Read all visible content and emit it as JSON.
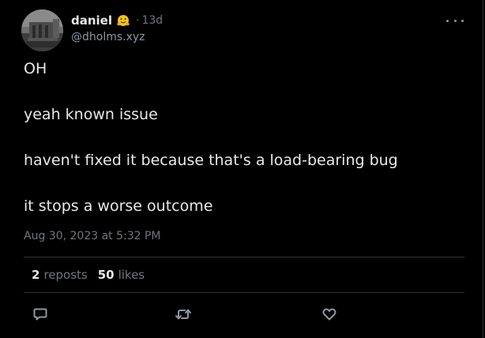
{
  "author": {
    "display_name": "daniel",
    "handle": "@dholms.xyz",
    "emoji_icon": "hugging-face-emoji",
    "age_separator": "·",
    "age": "13d"
  },
  "post": {
    "lines": [
      "OH",
      "yeah known issue",
      "haven't fixed it because that's a load-bearing bug",
      "it stops a worse outcome"
    ],
    "timestamp": "Aug 30, 2023 at 5:32 PM"
  },
  "stats": {
    "reposts_count": "2",
    "reposts_label": "reposts",
    "likes_count": "50",
    "likes_label": "likes"
  },
  "actions": {
    "reply_icon": "speech-bubble-icon",
    "repost_icon": "repost-arrows-icon",
    "like_icon": "heart-icon",
    "more_icon": "ellipsis-icon"
  },
  "colors": {
    "background": "#000000",
    "text_primary": "#e7e9ea",
    "text_secondary": "#71767b",
    "divider": "#2f3336",
    "icon": "#8b98a5"
  }
}
